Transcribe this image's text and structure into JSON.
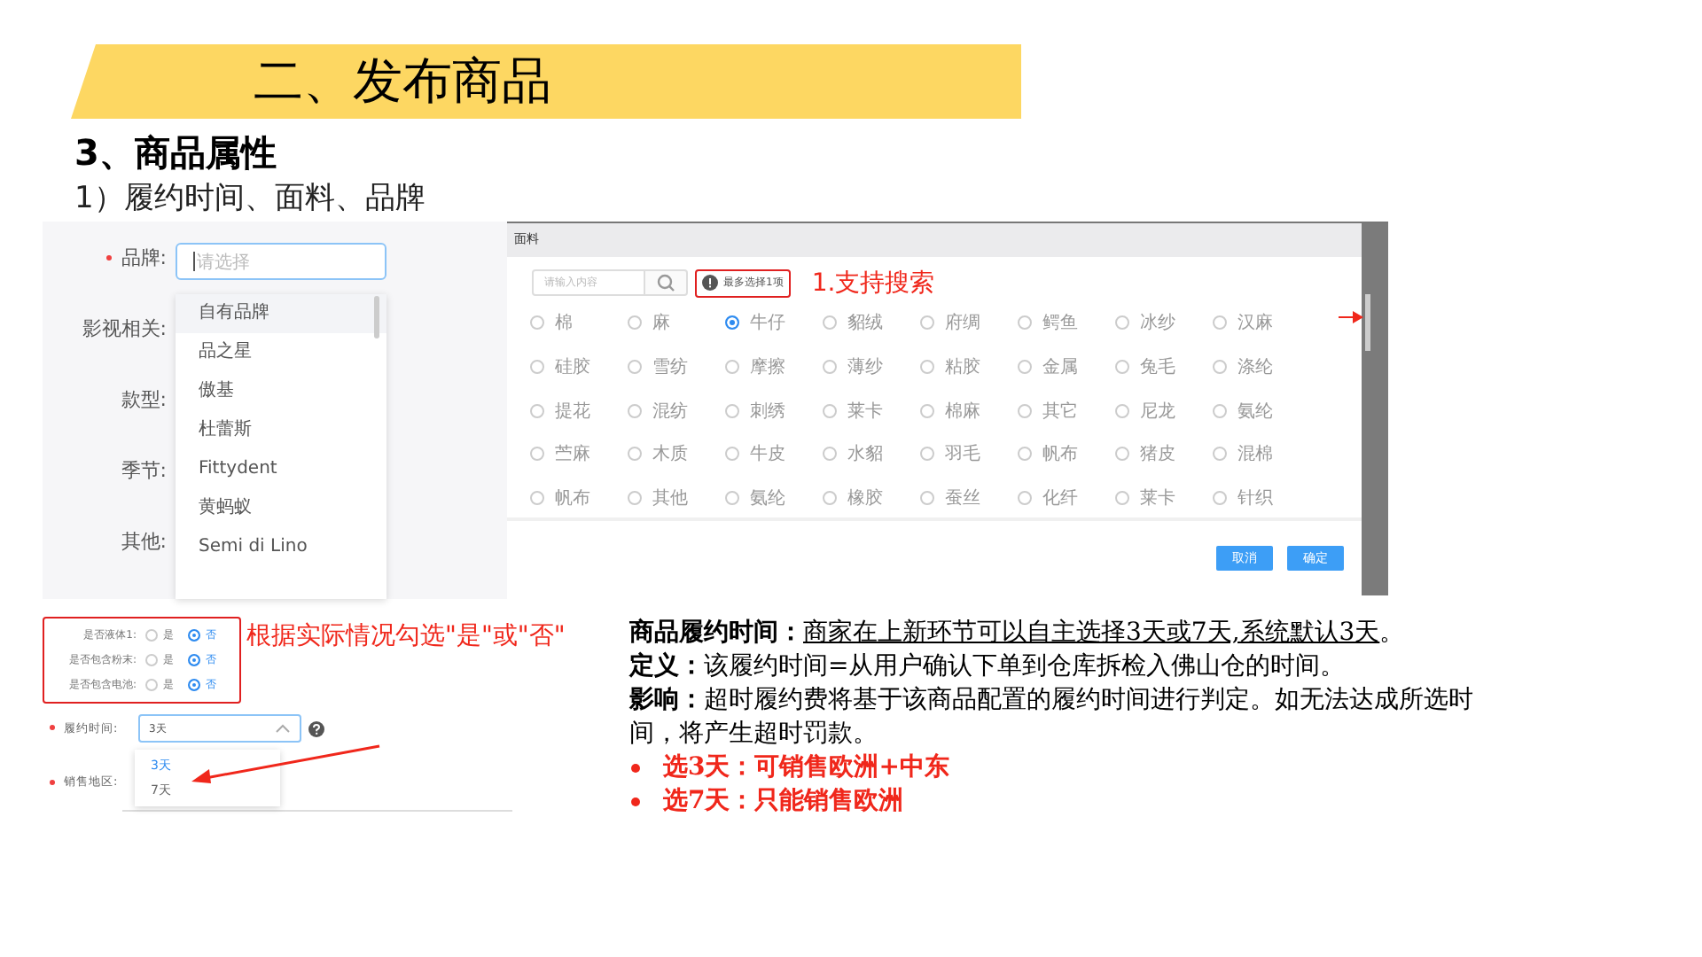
{
  "slide": {
    "title": "二、发布商品",
    "section": "3、商品属性",
    "subsection": "1）履约时间、面料、品牌"
  },
  "brand_form": {
    "fields": [
      {
        "label": "品牌:",
        "required": true
      },
      {
        "label": "影视相关:",
        "required": false
      },
      {
        "label": "款型:",
        "required": false
      },
      {
        "label": "季节:",
        "required": false
      },
      {
        "label": "其他:",
        "required": false
      }
    ],
    "select": {
      "placeholder": "请选择"
    },
    "options": [
      {
        "label": "自有品牌",
        "selected": true
      },
      {
        "label": "品之星",
        "selected": false
      },
      {
        "label": "傲基",
        "selected": false
      },
      {
        "label": "杜蕾斯",
        "selected": false
      },
      {
        "label": "Fittydent",
        "selected": false
      },
      {
        "label": "黄蚂蚁",
        "selected": false
      },
      {
        "label": "Semi di Lino",
        "selected": false
      }
    ]
  },
  "fabric_dialog": {
    "title": "面料",
    "search": {
      "placeholder": "请输入内容"
    },
    "hint": "最多选择1项",
    "annotation": "1.支持搜索",
    "options": [
      {
        "label": "棉",
        "selected": false
      },
      {
        "label": "麻",
        "selected": false
      },
      {
        "label": "牛仔",
        "selected": true
      },
      {
        "label": "貂绒",
        "selected": false
      },
      {
        "label": "府绸",
        "selected": false
      },
      {
        "label": "鳄鱼",
        "selected": false
      },
      {
        "label": "冰纱",
        "selected": false
      },
      {
        "label": "汉麻",
        "selected": false
      },
      {
        "label": "硅胶",
        "selected": false
      },
      {
        "label": "雪纺",
        "selected": false
      },
      {
        "label": "摩擦",
        "selected": false
      },
      {
        "label": "薄纱",
        "selected": false
      },
      {
        "label": "粘胶",
        "selected": false
      },
      {
        "label": "金属",
        "selected": false
      },
      {
        "label": "兔毛",
        "selected": false
      },
      {
        "label": "涤纶",
        "selected": false
      },
      {
        "label": "提花",
        "selected": false
      },
      {
        "label": "混纺",
        "selected": false
      },
      {
        "label": "刺绣",
        "selected": false
      },
      {
        "label": "莱卡",
        "selected": false
      },
      {
        "label": "棉麻",
        "selected": false
      },
      {
        "label": "其它",
        "selected": false
      },
      {
        "label": "尼龙",
        "selected": false
      },
      {
        "label": "氨纶",
        "selected": false
      },
      {
        "label": "苎麻",
        "selected": false
      },
      {
        "label": "木质",
        "selected": false
      },
      {
        "label": "牛皮",
        "selected": false
      },
      {
        "label": "水貂",
        "selected": false
      },
      {
        "label": "羽毛",
        "selected": false
      },
      {
        "label": "帆布",
        "selected": false
      },
      {
        "label": "猪皮",
        "selected": false
      },
      {
        "label": "混棉",
        "selected": false
      },
      {
        "label": "帆布",
        "selected": false
      },
      {
        "label": "其他",
        "selected": false
      },
      {
        "label": "氨纶",
        "selected": false
      },
      {
        "label": "橡胶",
        "selected": false
      },
      {
        "label": "蚕丝",
        "selected": false
      },
      {
        "label": "化纤",
        "selected": false
      },
      {
        "label": "莱卡",
        "selected": false
      },
      {
        "label": "针织",
        "selected": false
      }
    ],
    "buttons": [
      {
        "label": "取消"
      },
      {
        "label": "确定"
      }
    ]
  },
  "attribute_form": {
    "questions": [
      {
        "label": "是否液体1:",
        "options": [
          {
            "label": "是",
            "selected": false
          },
          {
            "label": "否",
            "selected": true
          }
        ]
      },
      {
        "label": "是否包含粉末:",
        "options": [
          {
            "label": "是",
            "selected": false
          },
          {
            "label": "否",
            "selected": true
          }
        ]
      },
      {
        "label": "是否包含电池:",
        "options": [
          {
            "label": "是",
            "selected": false
          },
          {
            "label": "否",
            "selected": true
          }
        ]
      }
    ],
    "annotation": "根据实际情况勾选\"是\"或\"否\"",
    "fulfillment": {
      "label": "履约时间:",
      "required": true,
      "value": "3天",
      "options": [
        {
          "label": "3天",
          "selected": true
        },
        {
          "label": "7天",
          "selected": false
        }
      ]
    },
    "region": {
      "label": "销售地区:",
      "required": true
    }
  },
  "notes": [
    {
      "kind": "term",
      "term": "商品履约时间：",
      "text": "商家在上新环节可以自主选择3天或7天,系统默认3天",
      "underlined": true,
      "tail": "。"
    },
    {
      "kind": "term",
      "term": "定义：",
      "text": "该履约时间=从用户确认下单到仓库拆检入佛山仓的时间。",
      "underlined": false
    },
    {
      "kind": "term",
      "term": "影响：",
      "text": "超时履约费将基于该商品配置的履约时间进行判定。如无法达成所选时间，将产生超时罚款。",
      "underlined": false
    },
    {
      "kind": "bullet",
      "text": "选3天：可销售欧洲+中东"
    },
    {
      "kind": "bullet",
      "text": "选7天：只能销售欧洲"
    }
  ]
}
